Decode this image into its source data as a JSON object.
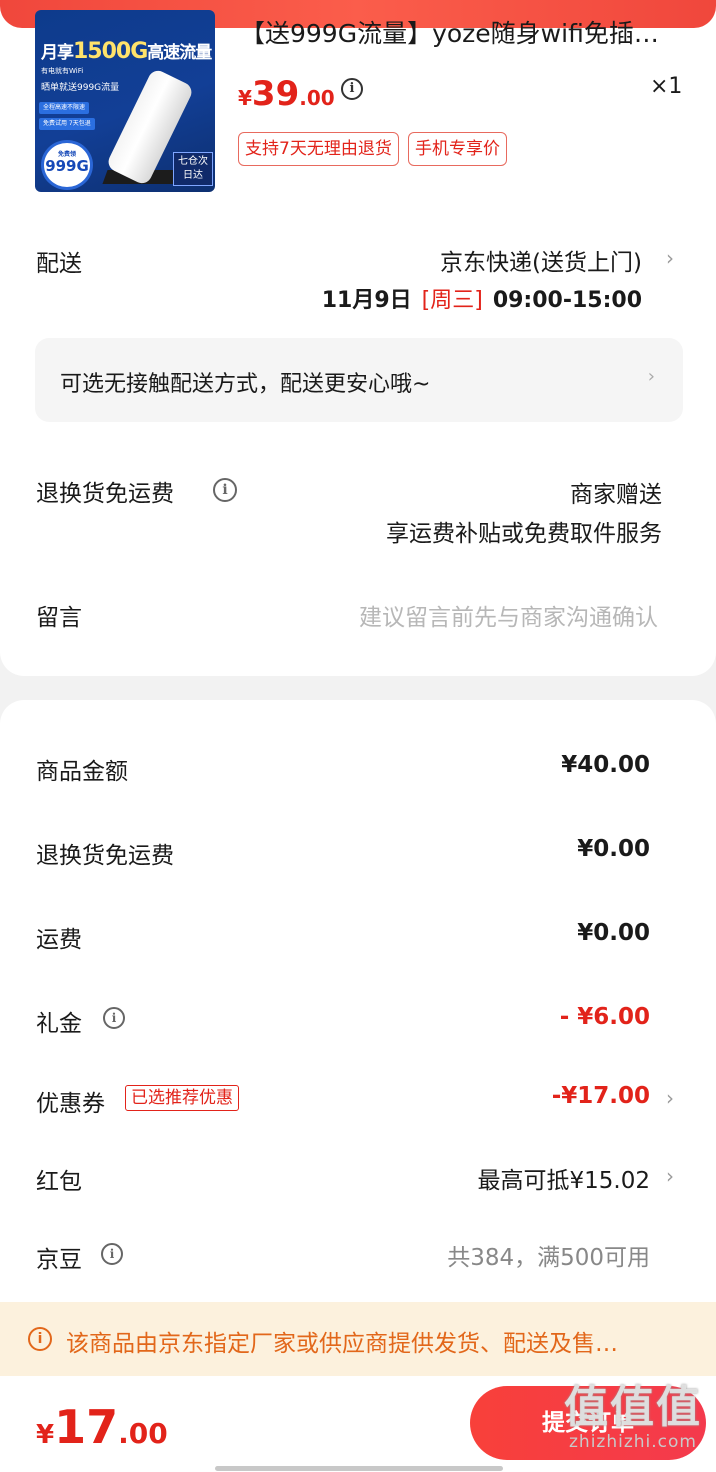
{
  "product": {
    "title": "【送999G流量】yoze随身wifi免插…",
    "price_currency": "¥",
    "price_int": "39",
    "price_dec": ".00",
    "quantity": "×1",
    "tags": [
      "支持7天无理由退货",
      "手机专享价"
    ],
    "image_text": {
      "headline_a": "月享",
      "headline_b": "1500G",
      "headline_c": "高速流量",
      "line1": "有电就有WiFi",
      "line2": "晒单就送999G流量",
      "chip1": "全程高速不限速",
      "chip2": "免费试用 7天包退",
      "badge_small": "免费领",
      "badge_big": "999G",
      "corner": "七仓次日达"
    }
  },
  "delivery": {
    "label": "配送",
    "method": "京东快递(送货上门)",
    "date": "11月9日",
    "weekday": "[周三]",
    "time": "09:00-15:00"
  },
  "notice": {
    "text": "可选无接触配送方式，配送更安心哦~"
  },
  "return_shipping": {
    "label": "退换货免运费",
    "value1": "商家赠送",
    "value2": "享运费补贴或免费取件服务"
  },
  "message": {
    "label": "留言",
    "placeholder": "建议留言前先与商家沟通确认"
  },
  "summary": {
    "goods_label": "商品金额",
    "goods_value": "¥40.00",
    "return_label": "退换货免运费",
    "return_value": "¥0.00",
    "freight_label": "运费",
    "freight_value": "¥0.00",
    "gift_label": "礼金",
    "gift_value": "- ¥6.00",
    "coupon_label": "优惠券",
    "coupon_tag": "已选推荐优惠",
    "coupon_value": "-¥17.00",
    "redpack_label": "红包",
    "redpack_value": "最高可抵¥15.02",
    "bean_label": "京豆",
    "bean_value": "共384，满500可用"
  },
  "alert": {
    "text": "该商品由京东指定厂家或供应商提供发货、配送及售…"
  },
  "footer": {
    "total_currency": "¥",
    "total_int": "17",
    "total_dec": ".00",
    "submit_label": "提交订单"
  },
  "watermark": {
    "big": "值值值",
    "domain": "zhizhizhi.com"
  },
  "colors": {
    "accent": "#e2231a",
    "alert_text": "#e2671a",
    "alert_bg": "#fcf1dd"
  }
}
